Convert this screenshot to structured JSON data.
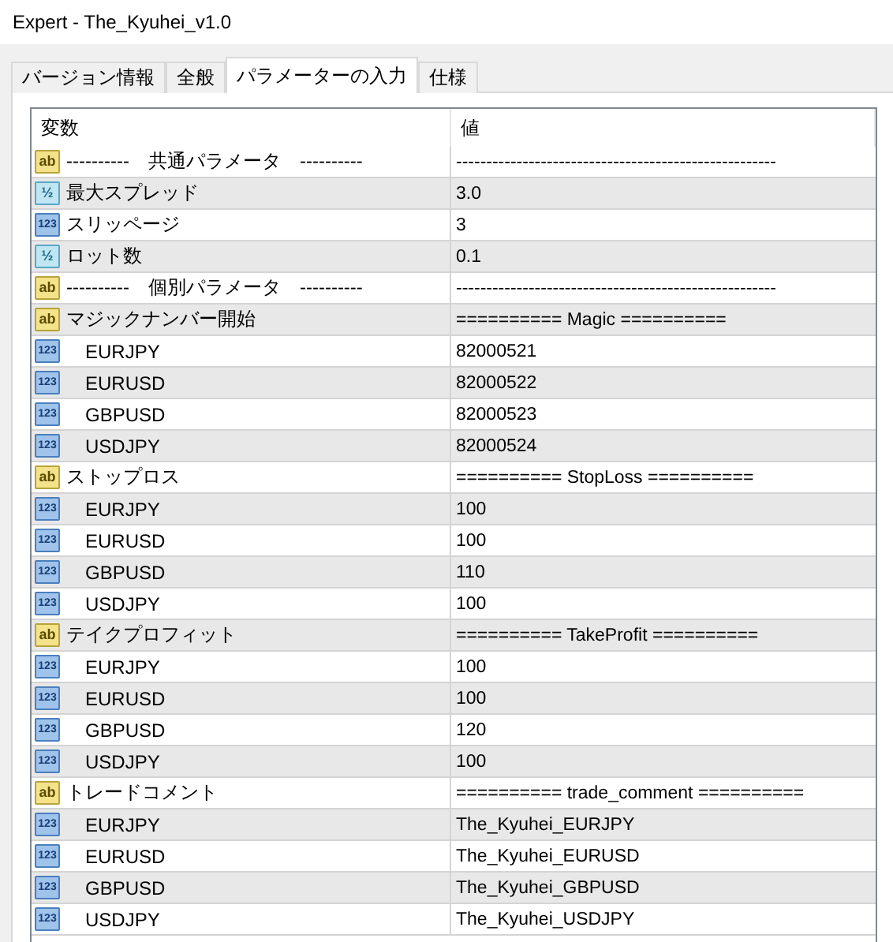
{
  "window": {
    "title": "Expert - The_Kyuhei_v1.0"
  },
  "tabs": [
    {
      "label": "バージョン情報",
      "selected": false
    },
    {
      "label": "全般",
      "selected": false
    },
    {
      "label": "パラメーターの入力",
      "selected": true
    },
    {
      "label": "仕様",
      "selected": false
    }
  ],
  "table": {
    "columns": [
      "変数",
      "値"
    ],
    "rows": [
      {
        "kind": "string",
        "icon": "ab",
        "name": "----------　共通パラメータ　----------",
        "value": "-----------------------------------------------------"
      },
      {
        "kind": "double",
        "icon": "½",
        "name": "最大スプレッド",
        "value": "3.0"
      },
      {
        "kind": "int",
        "icon": "123",
        "name": "スリッページ",
        "value": "3"
      },
      {
        "kind": "double",
        "icon": "½",
        "name": "ロット数",
        "value": "0.1"
      },
      {
        "kind": "string",
        "icon": "ab",
        "name": "----------　個別パラメータ　----------",
        "value": "-----------------------------------------------------"
      },
      {
        "kind": "string",
        "icon": "ab",
        "name": "マジックナンバー開始",
        "value": "==========  Magic ==========",
        "children": [
          {
            "kind": "int",
            "icon": "123",
            "name": "EURJPY",
            "value": "82000521"
          },
          {
            "kind": "int",
            "icon": "123",
            "name": "EURUSD",
            "value": "82000522"
          },
          {
            "kind": "int",
            "icon": "123",
            "name": "GBPUSD",
            "value": "82000523"
          },
          {
            "kind": "int",
            "icon": "123",
            "name": "USDJPY",
            "value": "82000524"
          }
        ]
      },
      {
        "kind": "string",
        "icon": "ab",
        "name": "ストップロス",
        "value": "==========  StopLoss ==========",
        "children": [
          {
            "kind": "int",
            "icon": "123",
            "name": "EURJPY",
            "value": "100"
          },
          {
            "kind": "int",
            "icon": "123",
            "name": "EURUSD",
            "value": "100"
          },
          {
            "kind": "int",
            "icon": "123",
            "name": "GBPUSD",
            "value": "110"
          },
          {
            "kind": "int",
            "icon": "123",
            "name": "USDJPY",
            "value": "100"
          }
        ]
      },
      {
        "kind": "string",
        "icon": "ab",
        "name": "テイクプロフィット",
        "value": "==========  TakeProfit ==========",
        "children": [
          {
            "kind": "int",
            "icon": "123",
            "name": "EURJPY",
            "value": "100"
          },
          {
            "kind": "int",
            "icon": "123",
            "name": "EURUSD",
            "value": "100"
          },
          {
            "kind": "int",
            "icon": "123",
            "name": "GBPUSD",
            "value": "120"
          },
          {
            "kind": "int",
            "icon": "123",
            "name": "USDJPY",
            "value": "100"
          }
        ]
      },
      {
        "kind": "string",
        "icon": "ab",
        "name": "トレードコメント",
        "value": "==========  trade_comment ==========",
        "children": [
          {
            "kind": "int",
            "icon": "123",
            "name": "EURJPY",
            "value": "The_Kyuhei_EURJPY"
          },
          {
            "kind": "int",
            "icon": "123",
            "name": "EURUSD",
            "value": "The_Kyuhei_EURUSD"
          },
          {
            "kind": "int",
            "icon": "123",
            "name": "GBPUSD",
            "value": "The_Kyuhei_GBPUSD"
          },
          {
            "kind": "int",
            "icon": "123",
            "name": "USDJPY",
            "value": "The_Kyuhei_USDJPY"
          }
        ]
      }
    ]
  }
}
